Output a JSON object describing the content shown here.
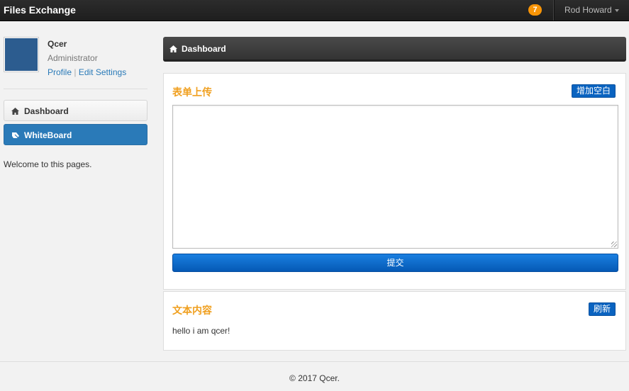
{
  "topbar": {
    "brand": "Files Exchange",
    "notification_count": "7",
    "user_name": "Rod Howard"
  },
  "profile": {
    "name": "Qcer",
    "role": "Administrator",
    "profile_link": "Profile",
    "separator": "|",
    "edit_link": "Edit Settings"
  },
  "sidebar": {
    "items": [
      {
        "label": "Dashboard",
        "icon": "home-icon"
      },
      {
        "label": "WhiteBoard",
        "icon": "whiteboard-icon"
      }
    ],
    "welcome": "Welcome to this pages."
  },
  "main": {
    "header_title": "Dashboard",
    "upload_panel": {
      "title": "表单上传",
      "add_button": "增加空白",
      "textarea_value": "",
      "submit_button": "提交"
    },
    "text_panel": {
      "title": "文本内容",
      "refresh_button": "刷新",
      "content": "hello i am qcer!"
    }
  },
  "footer": {
    "copyright": "© 2017 Qcer."
  },
  "colors": {
    "accent": "#2a7ab8",
    "panel_title": "#f0a020",
    "button": "#0a63c0",
    "notification": "#f89406"
  }
}
